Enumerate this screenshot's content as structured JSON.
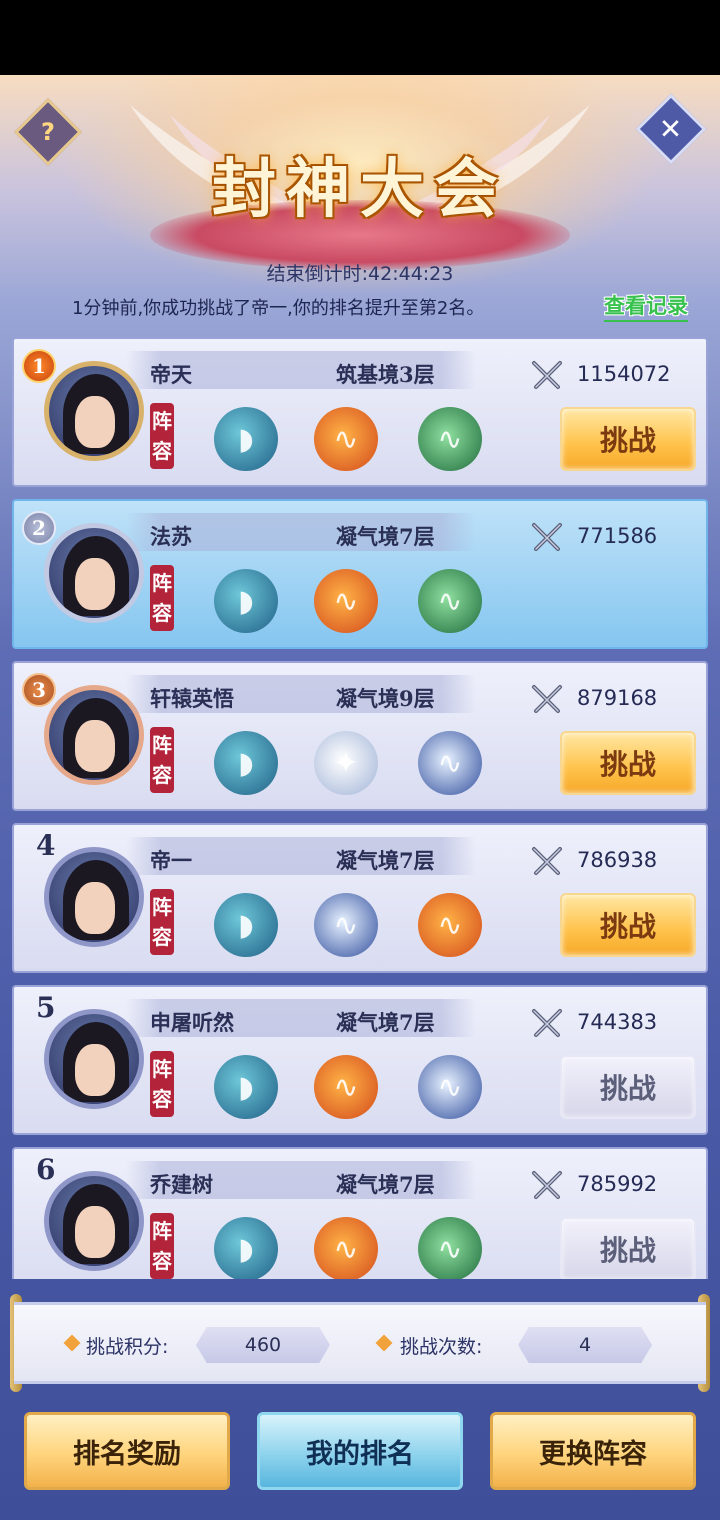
{
  "header": {
    "title": "封神大会",
    "help_symbol": "?",
    "close_symbol": "✕",
    "countdown": "结束倒计时:42:44:23",
    "notice": "1分钟前,你成功挑战了帝一,你的排名提升至第2名。",
    "view_log": "查看记录"
  },
  "lineup_tag": "阵容",
  "players": [
    {
      "rank": "1",
      "name": "帝天",
      "realm": "筑基境3层",
      "power": "1154072",
      "pets": [
        "whale",
        "dragon-red",
        "dragon-green"
      ],
      "button": "挑战",
      "button_state": "active"
    },
    {
      "rank": "2",
      "name": "法苏",
      "realm": "凝气境7层",
      "power": "771586",
      "pets": [
        "whale",
        "dragon-red",
        "dragon-green"
      ],
      "button": "",
      "button_state": "self"
    },
    {
      "rank": "3",
      "name": "轩辕英悟",
      "realm": "凝气境9层",
      "power": "879168",
      "pets": [
        "whale",
        "tiger",
        "dragon-blue"
      ],
      "button": "挑战",
      "button_state": "active"
    },
    {
      "rank": "4",
      "name": "帝一",
      "realm": "凝气境7层",
      "power": "786938",
      "pets": [
        "whale",
        "dragon-blue",
        "dragon-red"
      ],
      "button": "挑战",
      "button_state": "active"
    },
    {
      "rank": "5",
      "name": "申屠听然",
      "realm": "凝气境7层",
      "power": "744383",
      "pets": [
        "whale",
        "dragon-red",
        "dragon-blue"
      ],
      "button": "挑战",
      "button_state": "disabled"
    },
    {
      "rank": "6",
      "name": "乔建树",
      "realm": "凝气境7层",
      "power": "785992",
      "pets": [
        "whale",
        "dragon-red",
        "dragon-green"
      ],
      "button": "挑战",
      "button_state": "disabled"
    }
  ],
  "stats": {
    "score_label": "挑战积分:",
    "score_value": "460",
    "count_label": "挑战次数:",
    "count_value": "4"
  },
  "actions": {
    "rank_reward": "排名奖励",
    "my_rank": "我的排名",
    "change_lineup": "更换阵容"
  },
  "colors": {
    "gold_button": "#ffc24a",
    "self_highlight": "#86c6f0",
    "view_log_green": "#37c24e"
  }
}
